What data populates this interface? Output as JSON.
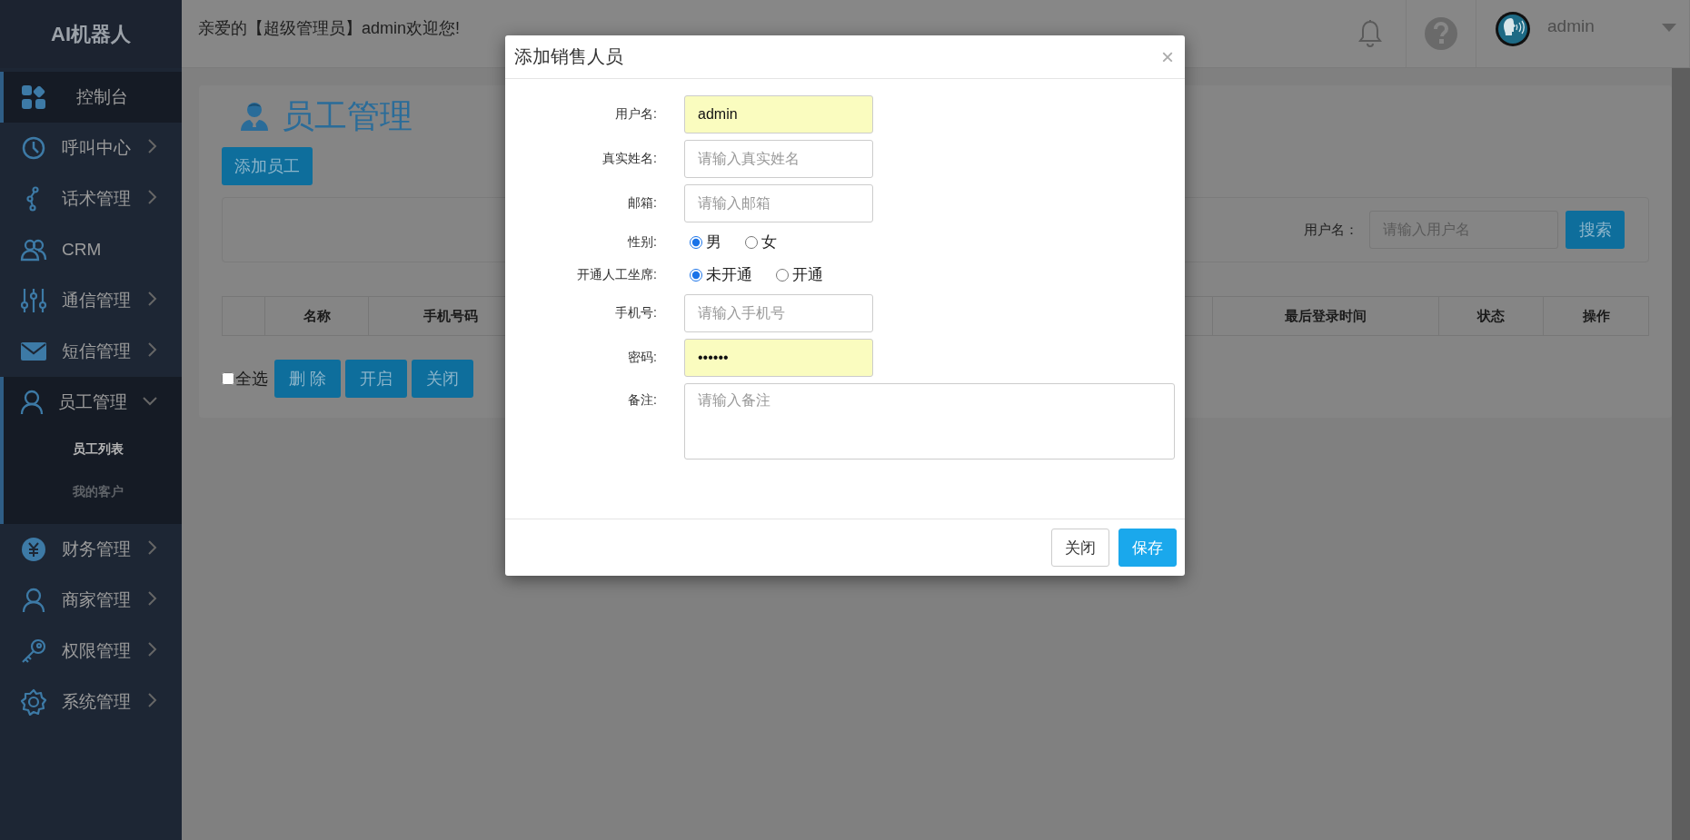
{
  "sidebar": {
    "logo": "AI机器人",
    "items": [
      {
        "label": "控制台",
        "selected": true
      },
      {
        "label": "呼叫中心",
        "selected": false,
        "expanded": false
      },
      {
        "label": "话术管理",
        "selected": false,
        "expanded": false
      },
      {
        "label": "CRM",
        "selected": false
      },
      {
        "label": "通信管理",
        "selected": false,
        "expanded": false
      },
      {
        "label": "短信管理",
        "selected": false,
        "expanded": false
      },
      {
        "label": "员工管理",
        "selected": false,
        "expanded": true,
        "children": [
          {
            "label": "员工列表",
            "selected": true
          },
          {
            "label": "我的客户",
            "selected": false
          }
        ]
      },
      {
        "label": "财务管理",
        "selected": false,
        "expanded": false
      },
      {
        "label": "商家管理",
        "selected": false,
        "expanded": false
      },
      {
        "label": "权限管理",
        "selected": false,
        "expanded": false
      },
      {
        "label": "系统管理",
        "selected": false,
        "expanded": false
      }
    ]
  },
  "header": {
    "greeting": "亲爱的【超级管理员】admin欢迎您!",
    "user": "admin"
  },
  "page": {
    "title": "员工管理",
    "add_button": "添加员工",
    "search": {
      "label": "用户名：",
      "placeholder": "请输入用户名",
      "button": "搜索"
    },
    "table": {
      "columns": [
        "名称",
        "手机号码",
        "最后登录时间",
        "状态",
        "操作"
      ]
    },
    "select_all": {
      "label": "全选",
      "checked": false
    },
    "bulk_buttons": [
      "删 除",
      "开启",
      "关闭"
    ]
  },
  "dialog": {
    "title": "添加销售人员",
    "close": "×",
    "fields": [
      {
        "kind": "text",
        "label": "用户名:",
        "value": "admin",
        "autofilled": true
      },
      {
        "kind": "text",
        "label": "真实姓名:",
        "placeholder": "请输入真实姓名",
        "autofilled": false
      },
      {
        "kind": "text",
        "label": "邮箱:",
        "placeholder": "请输入邮箱",
        "autofilled": false
      },
      {
        "kind": "radio",
        "label": "性别:",
        "options": [
          {
            "label": "男",
            "selected": true
          },
          {
            "label": "女",
            "selected": false
          }
        ]
      },
      {
        "kind": "radio",
        "label": "开通人工坐席:",
        "options": [
          {
            "label": "未开通",
            "selected": true
          },
          {
            "label": "开通",
            "selected": false
          }
        ]
      },
      {
        "kind": "text",
        "label": "手机号:",
        "placeholder": "请输入手机号",
        "autofilled": false
      },
      {
        "kind": "text",
        "label": "密码:",
        "value": "••••••",
        "autofilled": true
      },
      {
        "kind": "textarea",
        "label": "备注:",
        "placeholder": "请输入备注"
      }
    ],
    "buttons": [
      {
        "label": "关闭",
        "kind": "default"
      },
      {
        "label": "保存",
        "kind": "primary"
      }
    ]
  }
}
